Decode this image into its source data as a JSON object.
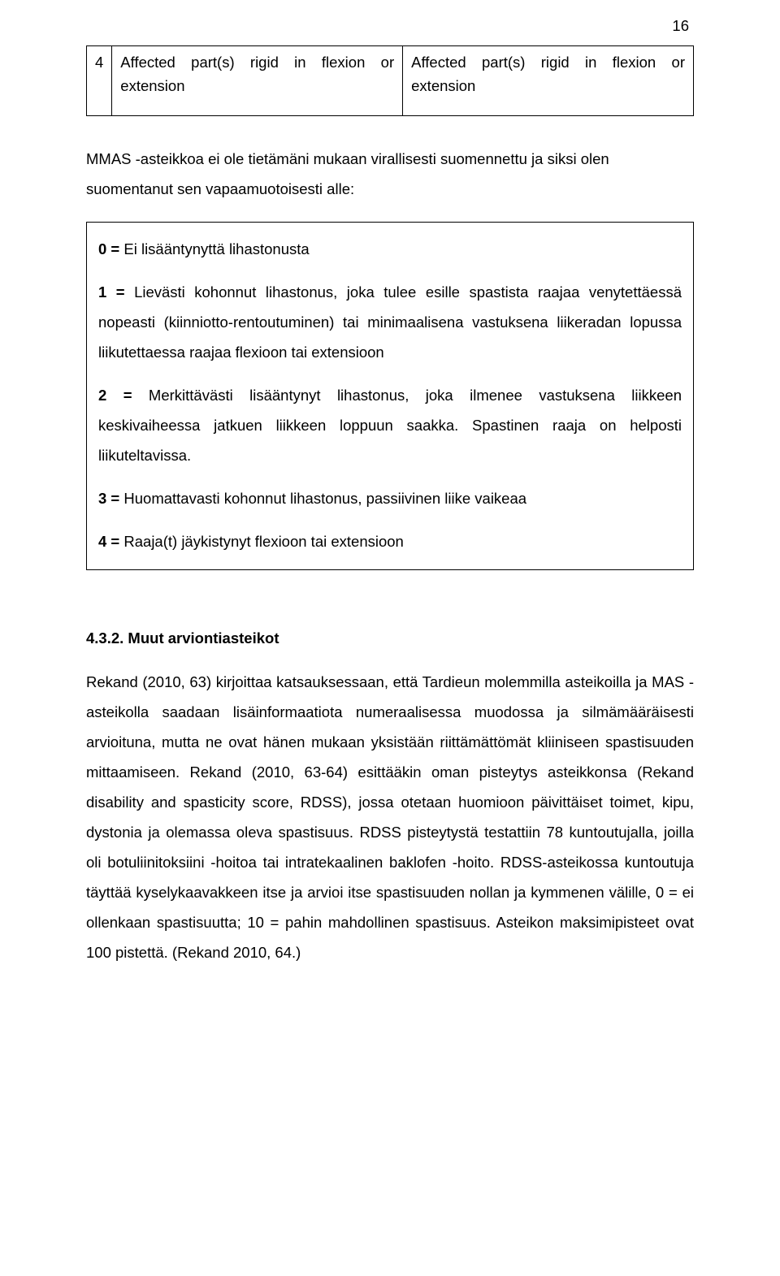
{
  "page_number": "16",
  "table": {
    "row_num": "4",
    "col1_line1": "Affected part(s) rigid in flexion or",
    "col1_line2": "extension",
    "col2_line1": "Affected part(s) rigid in flexion or",
    "col2_line2": "extension"
  },
  "intro": "MMAS -asteikkoa ei ole tietämäni mukaan virallisesti suomennettu ja siksi olen suomentanut sen vapaamuotoisesti alle:",
  "scale": {
    "item0_label": "0 = ",
    "item0_text": "Ei lisääntynyttä lihastonusta",
    "item1_label": "1 = ",
    "item1_text": "Lievästi kohonnut lihastonus, joka tulee esille spastista raajaa venytettäessä nopeasti (kiinniotto-rentoutuminen) tai minimaalisena vastuksena liikeradan lopussa liikutettaessa raajaa flexioon tai extensioon",
    "item2_label": "2 = ",
    "item2_text": "Merkittävästi lisääntynyt lihastonus, joka ilmenee vastuksena liikkeen keskivaiheessa jatkuen liikkeen loppuun saakka. Spastinen raaja on helposti liikuteltavissa.",
    "item3_label": "3 = ",
    "item3_text": "Huomattavasti kohonnut lihastonus, passiivinen liike vaikeaa",
    "item4_label": "4 = ",
    "item4_text": "Raaja(t) jäykistynyt flexioon tai extensioon"
  },
  "section_heading": "4.3.2. Muut arviontiasteikot",
  "body": "Rekand (2010, 63) kirjoittaa katsauksessaan, että Tardieun molemmilla asteikoilla ja MAS -asteikolla saadaan lisäinformaatiota numeraalisessa muodossa ja silmämääräisesti arvioituna, mutta ne ovat hänen mukaan yksistään riittämättömät kliiniseen spastisuuden mittaamiseen. Rekand (2010, 63-64) esittääkin oman pisteytys asteikkonsa (Rekand disability and spasticity score, RDSS), jossa otetaan huomioon päivittäiset toimet, kipu, dystonia ja olemassa oleva spastisuus. RDSS pisteytystä testattiin 78 kuntoutujalla, joilla oli botuliinitoksiini -hoitoa tai intratekaalinen baklofen -hoito. RDSS-asteikossa kuntoutuja täyttää kyselykaavakkeen itse ja arvioi itse spastisuuden nollan ja kymmenen välille, 0 = ei ollenkaan spastisuutta; 10 = pahin mahdollinen spastisuus. Asteikon maksimipisteet ovat 100 pistettä. (Rekand 2010, 64.)"
}
